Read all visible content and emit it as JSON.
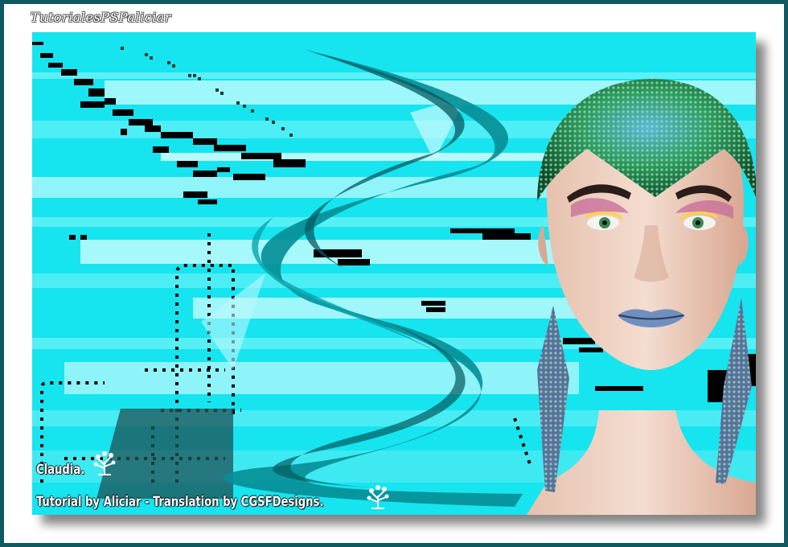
{
  "watermark": {
    "text": "TutorialesPSPaliciar"
  },
  "credits": {
    "title": "Claudia.",
    "line": "Tutorial by Aliciar - Translation by CGSFDesigns."
  },
  "colors": {
    "border": "#0e5a5e",
    "background_cyan": "#16e4ef",
    "ribbon_teal": "#078f97",
    "ribbon_dark": "#045a60",
    "pixel_black": "#000000"
  },
  "icons": {
    "decor_1": "tree-flower-icon",
    "decor_2": "tree-flower-icon"
  }
}
